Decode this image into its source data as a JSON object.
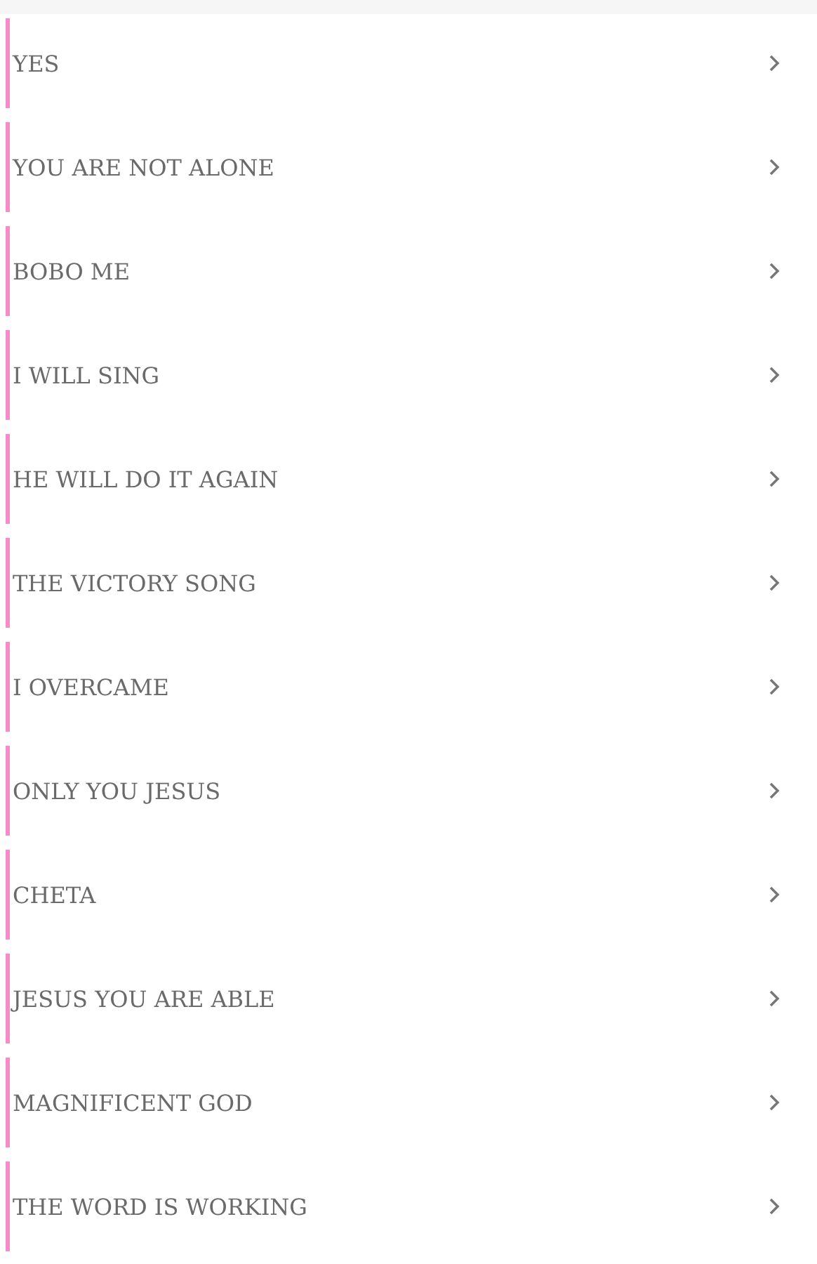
{
  "songs": [
    {
      "title": "YES"
    },
    {
      "title": "YOU ARE NOT ALONE"
    },
    {
      "title": "BOBO ME"
    },
    {
      "title": "I WILL SING"
    },
    {
      "title": "HE WILL DO IT AGAIN"
    },
    {
      "title": "THE VICTORY SONG"
    },
    {
      "title": "I OVERCAME"
    },
    {
      "title": "ONLY YOU JESUS"
    },
    {
      "title": "CHETA"
    },
    {
      "title": "JESUS YOU ARE ABLE"
    },
    {
      "title": "MAGNIFICENT GOD"
    },
    {
      "title": "THE WORD IS WORKING"
    }
  ]
}
